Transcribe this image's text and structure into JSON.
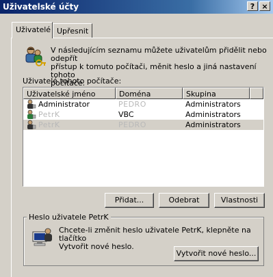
{
  "window": {
    "title": "Uživatelské účty",
    "help_label": "?",
    "close_label": "×"
  },
  "tabs": [
    {
      "label": "Uživatelé"
    },
    {
      "label": "Upřesnit"
    }
  ],
  "intro": {
    "text_line1": "V následujícím seznamu můžete uživatelům přidělit nebo odepřít",
    "text_line2": "přístup k tomuto počítači, měnit heslo a jiná nastavení tohoto",
    "text_line3": "počítače."
  },
  "users_list": {
    "label": "Uživatelé tohoto počítače:",
    "columns": [
      "Uživatelské jméno",
      "Doména",
      "Skupina"
    ],
    "rows": [
      {
        "name": "Administrator",
        "domain": "PEDRO",
        "group": "Administrators",
        "selected": false
      },
      {
        "name": "PetrK",
        "domain": "VBC",
        "group": "Administrators",
        "selected": false
      },
      {
        "name": "PetrK",
        "domain": "PEDRO",
        "group": "Administrators",
        "selected": true
      }
    ]
  },
  "buttons": {
    "add": "Přidat...",
    "remove": "Odebrat",
    "properties": "Vlastnosti"
  },
  "password_group": {
    "legend": "Heslo uživatele PetrK",
    "text_line1": "Chcete-li změnit heslo uživatele PetrK, klepněte na tlačítko",
    "text_line2": "Vytvořit nové heslo.",
    "button": "Vytvořit nové heslo..."
  }
}
